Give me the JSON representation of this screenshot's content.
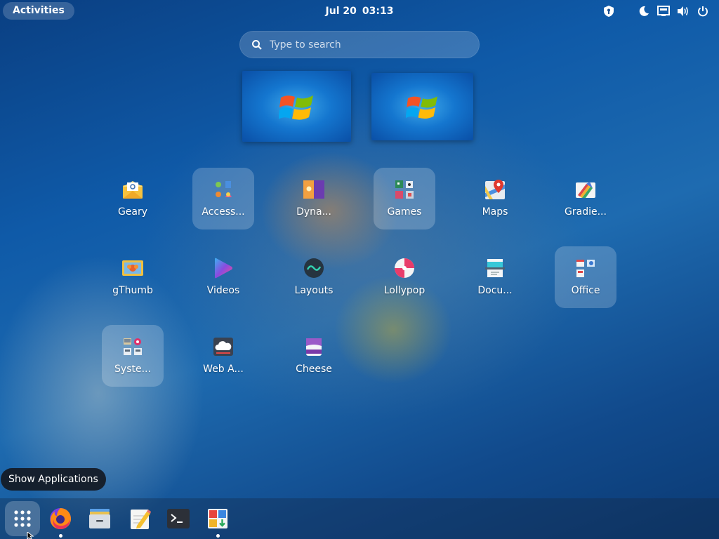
{
  "topbar": {
    "activities_label": "Activities",
    "date": "Jul 20",
    "time": "03:13",
    "tray_icons": [
      "privacy-indicator-icon",
      "night-light-icon",
      "network-icon",
      "volume-icon",
      "power-icon"
    ]
  },
  "search": {
    "placeholder": "Type to search",
    "value": ""
  },
  "workspaces": [
    {
      "name": "workspace-1"
    },
    {
      "name": "workspace-2"
    }
  ],
  "apps": [
    {
      "label": "Geary",
      "icon": "geary-icon",
      "folder": false
    },
    {
      "label": "Access...",
      "icon": "accessories-folder-icon",
      "folder": true
    },
    {
      "label": "Dyna...",
      "icon": "dynamic-wallpaper-icon",
      "folder": false
    },
    {
      "label": "Games",
      "icon": "games-folder-icon",
      "folder": true
    },
    {
      "label": "Maps",
      "icon": "maps-icon",
      "folder": false
    },
    {
      "label": "Gradie...",
      "icon": "gradience-icon",
      "folder": false
    },
    {
      "label": "gThumb",
      "icon": "gthumb-icon",
      "folder": false
    },
    {
      "label": "Videos",
      "icon": "videos-icon",
      "folder": false
    },
    {
      "label": "Layouts",
      "icon": "layouts-icon",
      "folder": false
    },
    {
      "label": "Lollypop",
      "icon": "lollypop-icon",
      "folder": false
    },
    {
      "label": "Docu...",
      "icon": "document-scanner-icon",
      "folder": false
    },
    {
      "label": "Office",
      "icon": "office-folder-icon",
      "folder": true
    },
    {
      "label": "Syste...",
      "icon": "system-folder-icon",
      "folder": true
    },
    {
      "label": "Web A...",
      "icon": "web-apps-icon",
      "folder": false
    },
    {
      "label": "Cheese",
      "icon": "cheese-icon",
      "folder": false
    }
  ],
  "tooltip": {
    "text": "Show Applications"
  },
  "dock": {
    "items": [
      {
        "name": "show-applications",
        "icon": "app-grid-icon",
        "active": true,
        "running": false
      },
      {
        "name": "firefox",
        "icon": "firefox-icon",
        "active": false,
        "running": true
      },
      {
        "name": "files",
        "icon": "files-icon",
        "active": false,
        "running": false
      },
      {
        "name": "text-editor",
        "icon": "text-editor-icon",
        "active": false,
        "running": false
      },
      {
        "name": "terminal",
        "icon": "terminal-icon",
        "active": false,
        "running": false
      },
      {
        "name": "software",
        "icon": "software-icon",
        "active": false,
        "running": true
      }
    ]
  }
}
